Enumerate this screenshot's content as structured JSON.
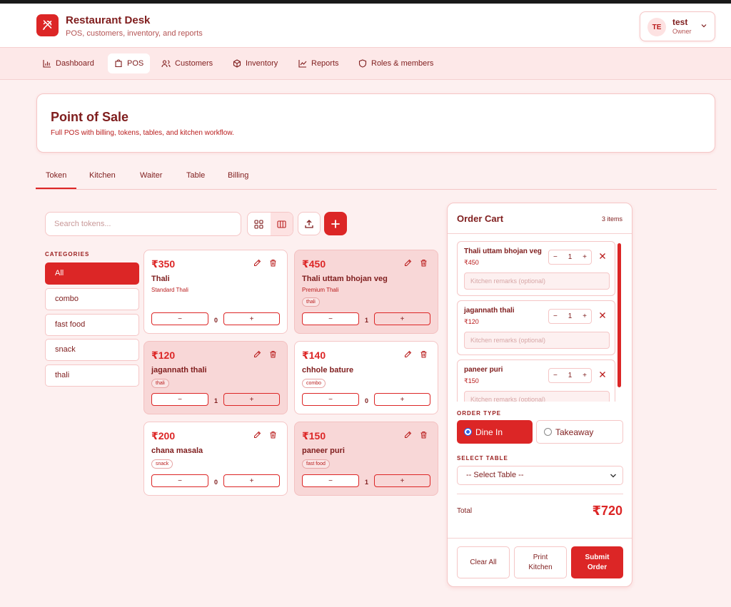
{
  "app": {
    "title": "Restaurant Desk",
    "subtitle": "POS, customers, inventory, and reports",
    "logo_icon": "utensils-icon"
  },
  "user": {
    "initials": "TE",
    "name": "test",
    "role": "Owner"
  },
  "nav": {
    "items": [
      {
        "label": "Dashboard",
        "icon": "bar-chart-icon",
        "active": false
      },
      {
        "label": "POS",
        "icon": "shopping-bag-icon",
        "active": true
      },
      {
        "label": "Customers",
        "icon": "users-icon",
        "active": false
      },
      {
        "label": "Inventory",
        "icon": "box-icon",
        "active": false
      },
      {
        "label": "Reports",
        "icon": "line-chart-icon",
        "active": false
      },
      {
        "label": "Roles & members",
        "icon": "shield-icon",
        "active": false
      }
    ]
  },
  "page": {
    "title": "Point of Sale",
    "subtitle": "Full POS with billing, tokens, tables, and kitchen workflow."
  },
  "subtabs": [
    "Token",
    "Kitchen",
    "Waiter",
    "Table",
    "Billing"
  ],
  "active_subtab": "Token",
  "search": {
    "placeholder": "Search tokens..."
  },
  "categories": {
    "heading": "CATEGORIES",
    "items": [
      "All",
      "combo",
      "fast food",
      "snack",
      "thali"
    ],
    "active": "All"
  },
  "products": [
    {
      "price": "₹350",
      "name": "Thali",
      "desc": "Standard Thali",
      "tag": "",
      "qty": "0",
      "selected": false
    },
    {
      "price": "₹450",
      "name": "Thali uttam bhojan veg",
      "desc": "Premium Thali",
      "tag": "thali",
      "qty": "1",
      "selected": true
    },
    {
      "price": "₹120",
      "name": "jagannath thali",
      "desc": "",
      "tag": "thali",
      "qty": "1",
      "selected": true
    },
    {
      "price": "₹140",
      "name": "chhole bature",
      "desc": "",
      "tag": "combo",
      "qty": "0",
      "selected": false
    },
    {
      "price": "₹200",
      "name": "chana masala",
      "desc": "",
      "tag": "snack",
      "qty": "0",
      "selected": false
    },
    {
      "price": "₹150",
      "name": "paneer puri",
      "desc": "",
      "tag": "fast food",
      "qty": "1",
      "selected": true
    }
  ],
  "stepper": {
    "minus": "−",
    "plus": "+"
  },
  "cart": {
    "title": "Order Cart",
    "count": "3 items",
    "remarks_placeholder": "Kitchen remarks (optional)",
    "items": [
      {
        "name": "Thali uttam bhojan veg",
        "price": "₹450",
        "qty": "1"
      },
      {
        "name": "jagannath thali",
        "price": "₹120",
        "qty": "1"
      },
      {
        "name": "paneer puri",
        "price": "₹150",
        "qty": "1"
      }
    ],
    "order_type_label": "ORDER TYPE",
    "order_types": {
      "dine_in": "Dine In",
      "takeaway": "Takeaway"
    },
    "selected_order_type": "Dine In",
    "table_label": "SELECT TABLE",
    "table_value": "-- Select Table --",
    "total_label": "Total",
    "total_value": "₹720",
    "buttons": {
      "clear": "Clear All",
      "print_1": "Print",
      "print_2": "Kitchen",
      "submit_1": "Submit",
      "submit_2": "Order"
    }
  },
  "colors": {
    "accent": "#dc2626",
    "text": "#7f1d1d",
    "background": "#fdf0f0",
    "selected_tile": "#f8d7d7"
  }
}
